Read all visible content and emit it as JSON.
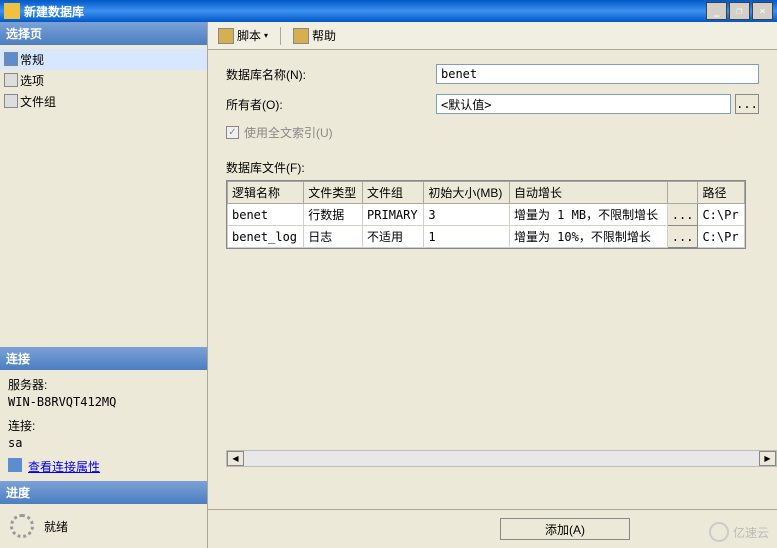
{
  "window": {
    "title": "新建数据库",
    "minimize": "_",
    "restore": "❐",
    "close": "✕"
  },
  "sidebar": {
    "select_page_header": "选择页",
    "nav": [
      {
        "label": "常规",
        "active": true
      },
      {
        "label": "选项",
        "active": false
      },
      {
        "label": "文件组",
        "active": false
      }
    ],
    "connection_header": "连接",
    "server_label": "服务器:",
    "server_value": "WIN-B8RVQT412MQ",
    "conn_label": "连接:",
    "conn_value": "sa",
    "view_props": "查看连接属性",
    "progress_header": "进度",
    "progress_status": "就绪"
  },
  "toolbar": {
    "script": "脚本",
    "help": "帮助",
    "dropdown": "▾"
  },
  "form": {
    "db_name_label": "数据库名称(N):",
    "db_name_value": "benet",
    "owner_label": "所有者(O):",
    "owner_value": "<默认值>",
    "browse": "...",
    "fulltext_label": "使用全文索引(U)",
    "files_label": "数据库文件(F):"
  },
  "grid": {
    "headers": [
      "逻辑名称",
      "文件类型",
      "文件组",
      "初始大小(MB)",
      "自动增长",
      "",
      "路径"
    ],
    "rows": [
      {
        "name": "benet",
        "type": "行数据",
        "group": "PRIMARY",
        "size": "3",
        "growth": "增量为 1 MB，不限制增长",
        "path": "C:\\Pr"
      },
      {
        "name": "benet_log",
        "type": "日志",
        "group": "不适用",
        "size": "1",
        "growth": "增量为 10%，不限制增长",
        "path": "C:\\Pr"
      }
    ],
    "ellipsis": "..."
  },
  "footer": {
    "add": "添加(A)"
  },
  "watermark": "亿速云"
}
